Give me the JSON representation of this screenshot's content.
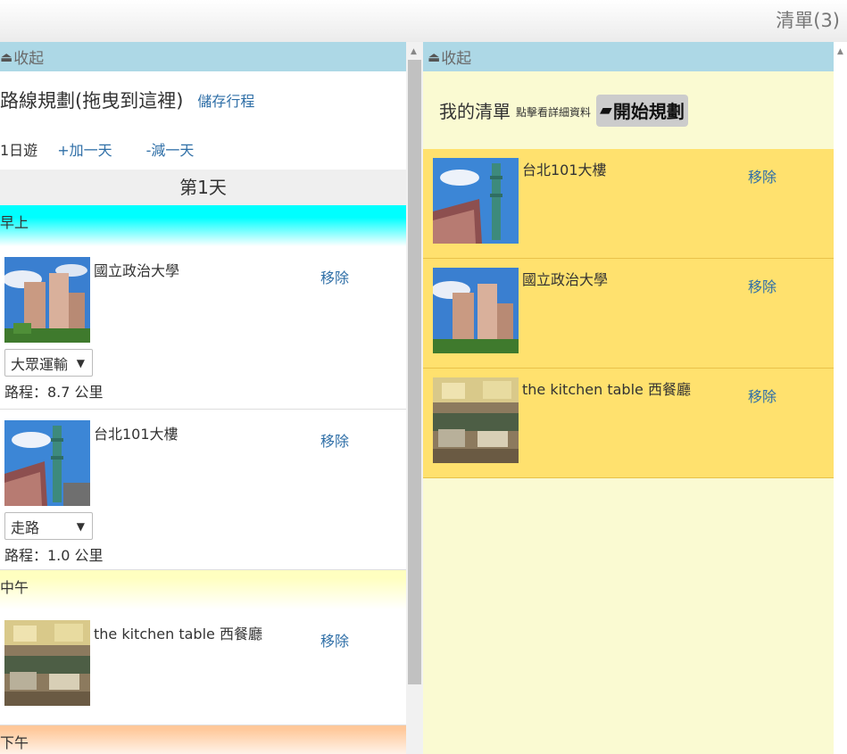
{
  "header": {
    "list_count": "清單(3)"
  },
  "left": {
    "collapse_label": "收起",
    "plan_title": "路線規劃(拖曳到這裡)",
    "save_label": "儲存行程",
    "days_label": "1日遊",
    "add_day": "+加一天",
    "remove_day": "-減一天",
    "day_title": "第1天",
    "periods": {
      "morning": "早上",
      "noon": "中午",
      "afternoon": "下午"
    },
    "items": [
      {
        "name": "國立政治大學",
        "remove": "移除",
        "transport": "大眾運輸",
        "distance": "路程：8.7 公里"
      },
      {
        "name": "台北101大樓",
        "remove": "移除",
        "transport": "走路",
        "distance": "路程：1.0 公里"
      },
      {
        "name": "the kitchen table 西餐廳",
        "remove": "移除"
      }
    ]
  },
  "right": {
    "collapse_label": "收起",
    "title": "我的清單",
    "hint": "點擊看詳細資料",
    "start_label": "開始規劃",
    "items": [
      {
        "name": "台北101大樓",
        "remove": "移除"
      },
      {
        "name": "國立政治大學",
        "remove": "移除"
      },
      {
        "name": "the kitchen table 西餐廳",
        "remove": "移除"
      }
    ]
  },
  "icons": {
    "collapse": "eject-up-triangle-icon",
    "transport_dropdown": "dropdown-arrow-icon",
    "start_logo": "route-logo-icon"
  }
}
